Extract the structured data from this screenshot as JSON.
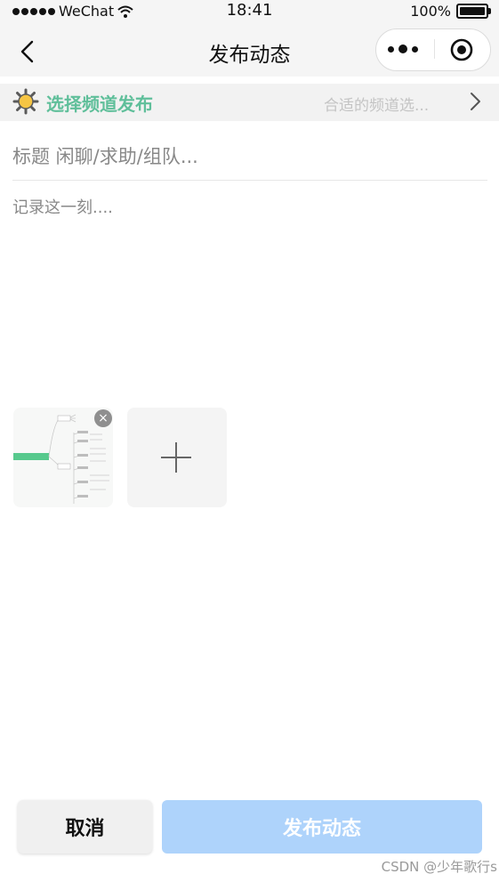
{
  "status_bar": {
    "carrier": "WeChat",
    "time": "18:41",
    "battery": "100%"
  },
  "nav": {
    "title": "发布动态",
    "back_icon": "chevron-left-icon",
    "more_icon": "more-icon",
    "close_icon": "target-icon"
  },
  "channel": {
    "label": "选择频道发布",
    "hint": "合适的频道选...",
    "icon": "sun-icon",
    "label_color": "#5fbf9a"
  },
  "form": {
    "title_placeholder": "标题 闲聊/求助/组队...",
    "content_placeholder": "记录这一刻...."
  },
  "images": {
    "remove_symbol": "×",
    "add_icon": "plus-icon"
  },
  "buttons": {
    "cancel": "取消",
    "publish": "发布动态",
    "publish_color": "#aed3fb"
  },
  "watermark": "CSDN @少年歌行s"
}
